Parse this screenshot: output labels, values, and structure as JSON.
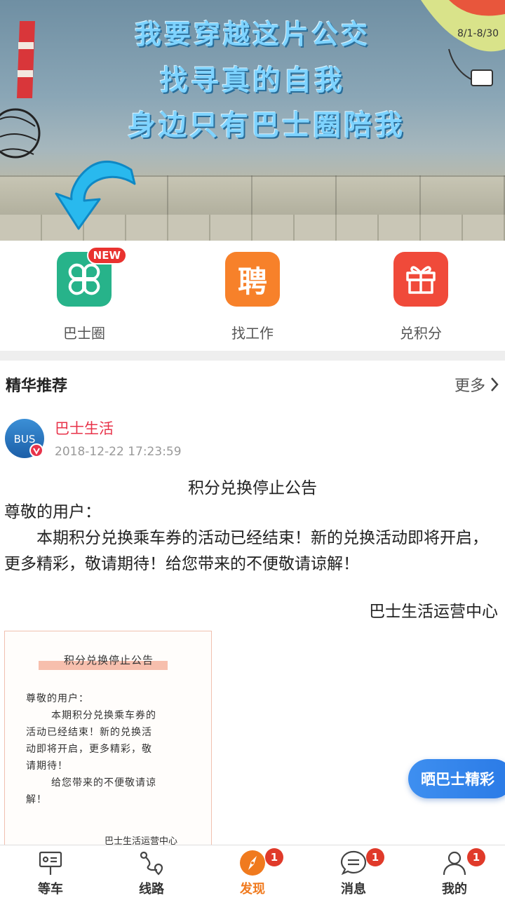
{
  "banner": {
    "slogan_lines": [
      "我要穿越这片公交",
      "找寻真的自我",
      "身边只有巴士圈陪我"
    ]
  },
  "quick_links": [
    {
      "label": "巴士圈",
      "icon": "clover-icon",
      "color": "#27b38a",
      "badge": "NEW"
    },
    {
      "label": "找工作",
      "icon": "hire-icon",
      "color": "#f7812a",
      "icon_text": "聘"
    },
    {
      "label": "兑积分",
      "icon": "gift-icon",
      "color": "#f04a3a"
    }
  ],
  "section": {
    "title": "精华推荐",
    "more_label": "更多"
  },
  "post": {
    "author": "巴士生活",
    "avatar_text": "BUS",
    "time": "2018-12-22 17:23:59",
    "title": "积分兑换停止公告",
    "greeting": "尊敬的用户：",
    "body": "本期积分兑换乘车券的活动已经结束！新的兑换活动即将开启，更多精彩，敬请期待！给您带来的不便敬请谅解！",
    "signature": "巴士生活运营中心",
    "image": {
      "title": "积分兑换停止公告",
      "greeting": "尊敬的用户：",
      "line1": "本期积分兑换乘车券的",
      "line2": "活动已经结束！新的兑换活",
      "line3": "动即将开启，更多精彩，敬",
      "line4": "请期待！",
      "line5": "给您带来的不便敬请谅",
      "line6": "解！",
      "signature": "巴士生活运营中心"
    }
  },
  "float_button": {
    "label": "晒巴士精彩"
  },
  "tabbar": [
    {
      "label": "等车",
      "icon": "bus-stop-icon"
    },
    {
      "label": "线路",
      "icon": "route-icon"
    },
    {
      "label": "发现",
      "icon": "compass-icon",
      "active": true,
      "badge": "1"
    },
    {
      "label": "消息",
      "icon": "message-icon",
      "badge": "1"
    },
    {
      "label": "我的",
      "icon": "profile-icon",
      "badge": "1"
    }
  ]
}
